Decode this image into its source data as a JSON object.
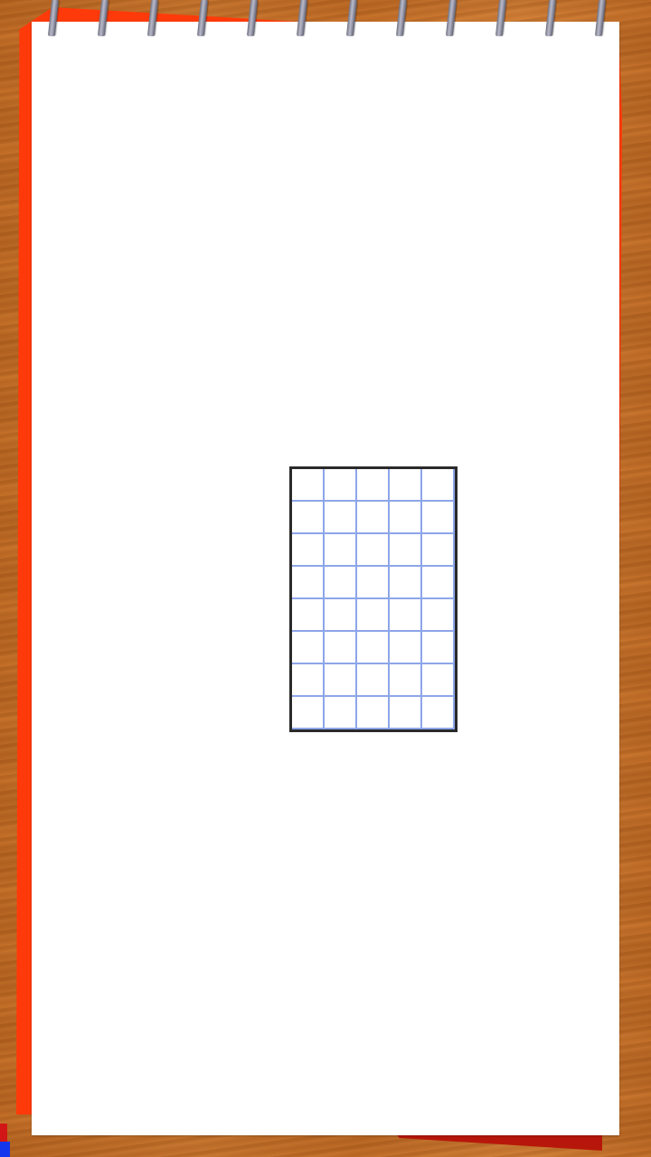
{
  "scene": {
    "background": "wood-table",
    "notebook": {
      "paper_color": "#ffffff",
      "back_sheet_color": "#ff3a0a",
      "ring_count": 12
    },
    "board": {
      "columns": 5,
      "rows": 8,
      "border_color": "#2a2a2a",
      "grid_line_color": "#8da6ea"
    }
  }
}
